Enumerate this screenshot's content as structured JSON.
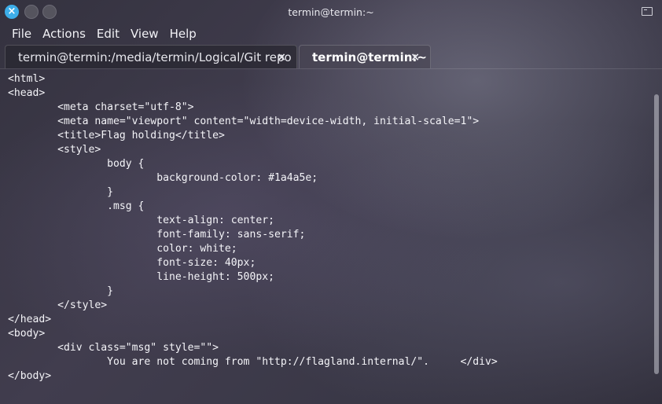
{
  "window": {
    "title": "termin@termin:~"
  },
  "menu": [
    "File",
    "Actions",
    "Edit",
    "View",
    "Help"
  ],
  "tabs": [
    {
      "label": "termin@termin:/media/termin/Logical/Git repo",
      "close": "×"
    },
    {
      "label": "termin@termin:~",
      "close": "×"
    }
  ],
  "terminal": {
    "lines": [
      "<html>",
      "<head>",
      "        <meta charset=\"utf-8\">",
      "        <meta name=\"viewport\" content=\"width=device-width, initial-scale=1\">",
      "        <title>Flag holding</title>",
      "        <style>",
      "                body {",
      "                        background-color: #1a4a5e;",
      "                }",
      "                .msg {",
      "                        text-align: center;",
      "                        font-family: sans-serif;",
      "                        color: white;",
      "                        font-size: 40px;",
      "                        line-height: 500px;",
      "                }",
      "        </style>",
      "</head>",
      "<body>",
      "        <div class=\"msg\" style=\"\">",
      "                You are not coming from \"http://flagland.internal/\".     </div>",
      "</body>"
    ]
  },
  "icons": {
    "close": "close-icon",
    "minimize": "minimize-icon",
    "maximize": "maximize-icon",
    "terminal": "terminal-icon"
  }
}
